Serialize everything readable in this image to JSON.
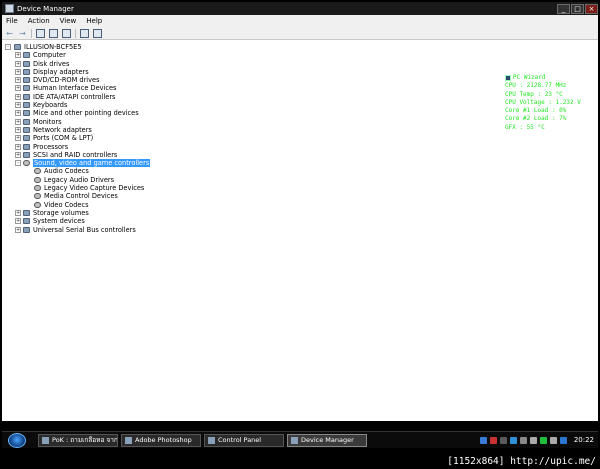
{
  "window": {
    "title": "Device Manager"
  },
  "menu": [
    "File",
    "Action",
    "View",
    "Help"
  ],
  "toolbar": [
    "back-icon",
    "forward-icon",
    "properties-icon",
    "print-icon",
    "help-icon",
    "scan-icon",
    "monitor-icon"
  ],
  "tree": {
    "root": "ILLUSION-BCF5E5",
    "categories": [
      {
        "label": "Computer",
        "icon": "computer-icon"
      },
      {
        "label": "Disk drives",
        "icon": "disk-icon"
      },
      {
        "label": "Display adapters",
        "icon": "display-icon"
      },
      {
        "label": "DVD/CD-ROM drives",
        "icon": "dvd-icon"
      },
      {
        "label": "Human Interface Devices",
        "icon": "hid-icon"
      },
      {
        "label": "IDE ATA/ATAPI controllers",
        "icon": "ide-icon"
      },
      {
        "label": "Keyboards",
        "icon": "keyboard-icon"
      },
      {
        "label": "Mice and other pointing devices",
        "icon": "mouse-icon"
      },
      {
        "label": "Monitors",
        "icon": "monitor-icon"
      },
      {
        "label": "Network adapters",
        "icon": "network-icon"
      },
      {
        "label": "Ports (COM & LPT)",
        "icon": "port-icon"
      },
      {
        "label": "Processors",
        "icon": "processor-icon"
      },
      {
        "label": "SCSI and RAID controllers",
        "icon": "scsi-icon"
      },
      {
        "label": "Sound, video and game controllers",
        "icon": "sound-icon",
        "expanded": true,
        "selected": true,
        "children": [
          "Audio Codecs",
          "Legacy Audio Drivers",
          "Legacy Video Capture Devices",
          "Media Control Devices",
          "Video Codecs"
        ]
      },
      {
        "label": "Storage volumes",
        "icon": "storage-icon"
      },
      {
        "label": "System devices",
        "icon": "system-icon"
      },
      {
        "label": "Universal Serial Bus controllers",
        "icon": "usb-icon"
      }
    ]
  },
  "overlay": {
    "title": "PC Wizard",
    "lines": [
      "CPU : 2128.77 MHz",
      "CPU Temp : 23 °C",
      "CPU Voltage : 1.232 V",
      "Core #1 Load : 0%",
      "Core #2 Load : 7%",
      "GFX : 55 °C"
    ]
  },
  "taskbar": {
    "items": [
      {
        "label": "PoK : ถามเกลือหอ จาก...",
        "active": false
      },
      {
        "label": "Adobe Photoshop",
        "active": false
      },
      {
        "label": "Control Panel",
        "active": false
      },
      {
        "label": "Device Manager",
        "active": true
      }
    ],
    "clock": "20:22"
  },
  "caption": "[1152x864] http://upic.me/"
}
